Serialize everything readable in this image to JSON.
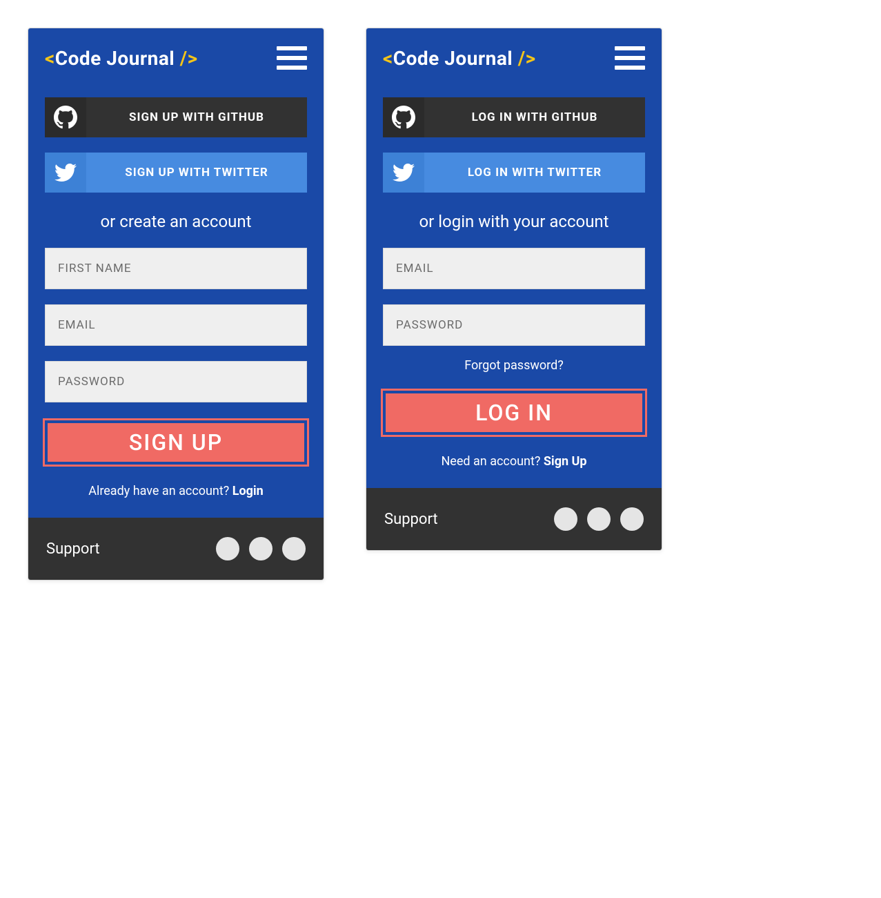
{
  "brand": {
    "open": "<",
    "name": "Code Journal",
    "close": " />"
  },
  "signup": {
    "github_label": "SIGN UP WITH GITHUB",
    "twitter_label": "SIGN UP WITH TWITTER",
    "divider": "or create an account",
    "fields": {
      "first_name": "FIRST NAME",
      "email": "EMAIL",
      "password": "PASSWORD"
    },
    "submit": "SIGN UP",
    "switch_prompt": "Already have an account? ",
    "switch_link": "Login"
  },
  "login": {
    "github_label": "LOG IN WITH GITHUB",
    "twitter_label": "LOG IN WITH TWITTER",
    "divider": "or login with your account",
    "fields": {
      "email": "EMAIL",
      "password": "PASSWORD"
    },
    "forgot": "Forgot password?",
    "submit": "LOG IN",
    "switch_prompt": "Need an account? ",
    "switch_link": "Sign Up"
  },
  "footer": {
    "support": "Support"
  }
}
